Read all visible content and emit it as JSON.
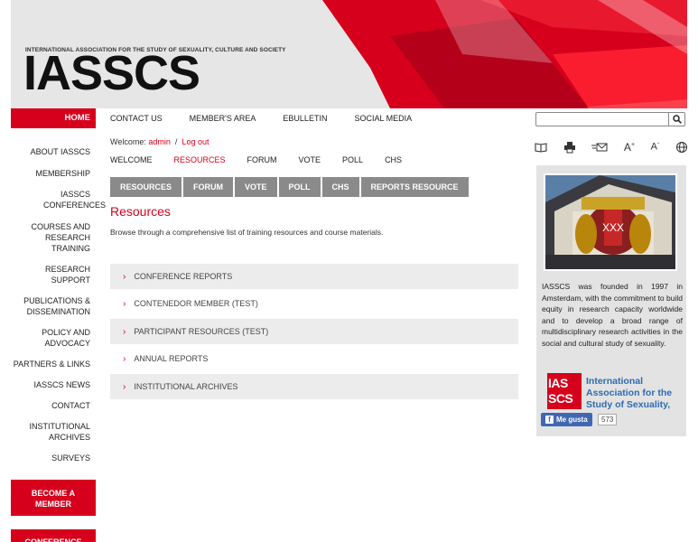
{
  "header": {
    "tagline": "INTERNATIONAL ASSOCIATION FOR THE STUDY OF SEXUALITY, CULTURE AND SOCIETY",
    "logo": "IASSCS",
    "accent": "#d6001c"
  },
  "sidebar": {
    "home": "HOME",
    "items": [
      {
        "label": "ABOUT IASSCS"
      },
      {
        "label": "MEMBERSHIP"
      },
      {
        "label": "IASSCS CONFERENCES"
      },
      {
        "label": "COURSES AND RESEARCH TRAINING"
      },
      {
        "label": "RESEARCH SUPPORT"
      },
      {
        "label": "PUBLICATIONS & DISSEMINATION"
      },
      {
        "label": "POLICY AND ADVOCACY"
      },
      {
        "label": "PARTNERS & LINKS"
      },
      {
        "label": "IASSCS NEWS"
      },
      {
        "label": "CONTACT"
      },
      {
        "label": "INSTITUTIONAL ARCHIVES"
      },
      {
        "label": "SURVEYS"
      }
    ],
    "cta_become_member": "BECOME A MEMBER",
    "cta_conference": "CONFERENCE"
  },
  "topnav": [
    "CONTACT US",
    "MEMBER'S AREA",
    "EBULLETIN",
    "SOCIAL MEDIA"
  ],
  "search": {
    "placeholder": ""
  },
  "welcome": {
    "prefix": "Welcome:",
    "user": "admin",
    "separator": "/",
    "logout": "Log out"
  },
  "subnav": [
    "WELCOME",
    "RESOURCES",
    "FORUM",
    "VOTE",
    "POLL",
    "CHS"
  ],
  "tabs": [
    "RESOURCES",
    "FORUM",
    "VOTE",
    "POLL",
    "CHS",
    "REPORTS RESOURCE"
  ],
  "main": {
    "title": "Resources",
    "intro": "Browse through a comprehensive list of training resources and course materials.",
    "accordion": [
      "CONFERENCE REPORTS",
      "CONTENEDOR MEMBER (TEST)",
      "PARTICIPANT RESOURCES (TEST)",
      "ANNUAL REPORTS",
      "INSTITUTIONAL ARCHIVES"
    ]
  },
  "tools": [
    "book-icon",
    "print-icon",
    "email-icon",
    "font-increase-icon",
    "font-decrease-icon",
    "globe-icon"
  ],
  "right_panel": {
    "description": "IASSCS was founded in 1997 in Amsterdam, with the commitment to build equity in research capacity worldwide and to develop a broad range of multidisciplinary research activities in the social and cultural study of sexuality.",
    "fb_logo_top": "IAS",
    "fb_logo_bottom": "SCS",
    "fb_title": "International Association for the Study of Sexuality,",
    "fb_like": "Me gusta",
    "fb_count": "573"
  }
}
